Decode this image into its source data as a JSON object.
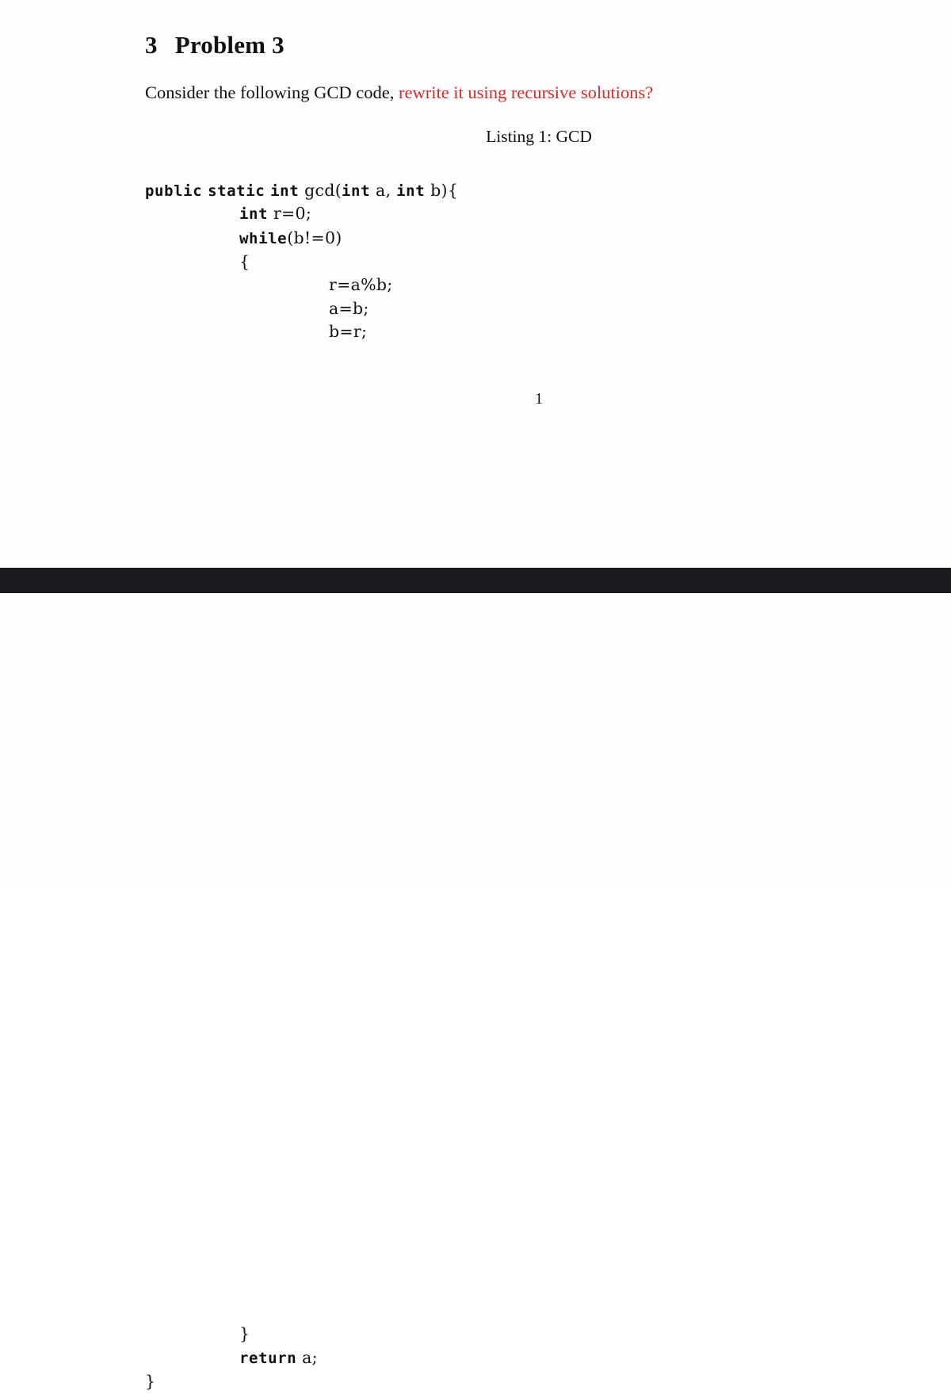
{
  "document": {
    "section": {
      "number": "3",
      "title": "Problem 3"
    },
    "prose": {
      "lead": "Consider the following GCD code, ",
      "accent": "rewrite it using recursive solutions?",
      "accent_color": "#d12b2b"
    },
    "listing": {
      "caption": "Listing 1: GCD",
      "language": "java",
      "lines": {
        "signature": {
          "kw_public": "public",
          "kw_static": "static",
          "kw_int": "int",
          "name": "gcd(",
          "kw_param_int_1": "int",
          "param_a": "a,",
          "kw_param_int_2": "int",
          "param_b": "b){"
        },
        "declare": {
          "kw": "int",
          "rest": "r=0;"
        },
        "loop": {
          "kw": "while",
          "condition": "(b!=0)"
        },
        "open_brace": "{",
        "body": [
          "r=a%b;",
          "a=b;",
          "b=r;"
        ],
        "close_brace": "}",
        "return": {
          "kw": "return",
          "value": "a;"
        },
        "final_brace": "}"
      }
    },
    "page_number": "1"
  },
  "page_colors": {
    "paper": "#fdfdfd",
    "page_break_band": "#191a1f",
    "text": "#111111"
  }
}
